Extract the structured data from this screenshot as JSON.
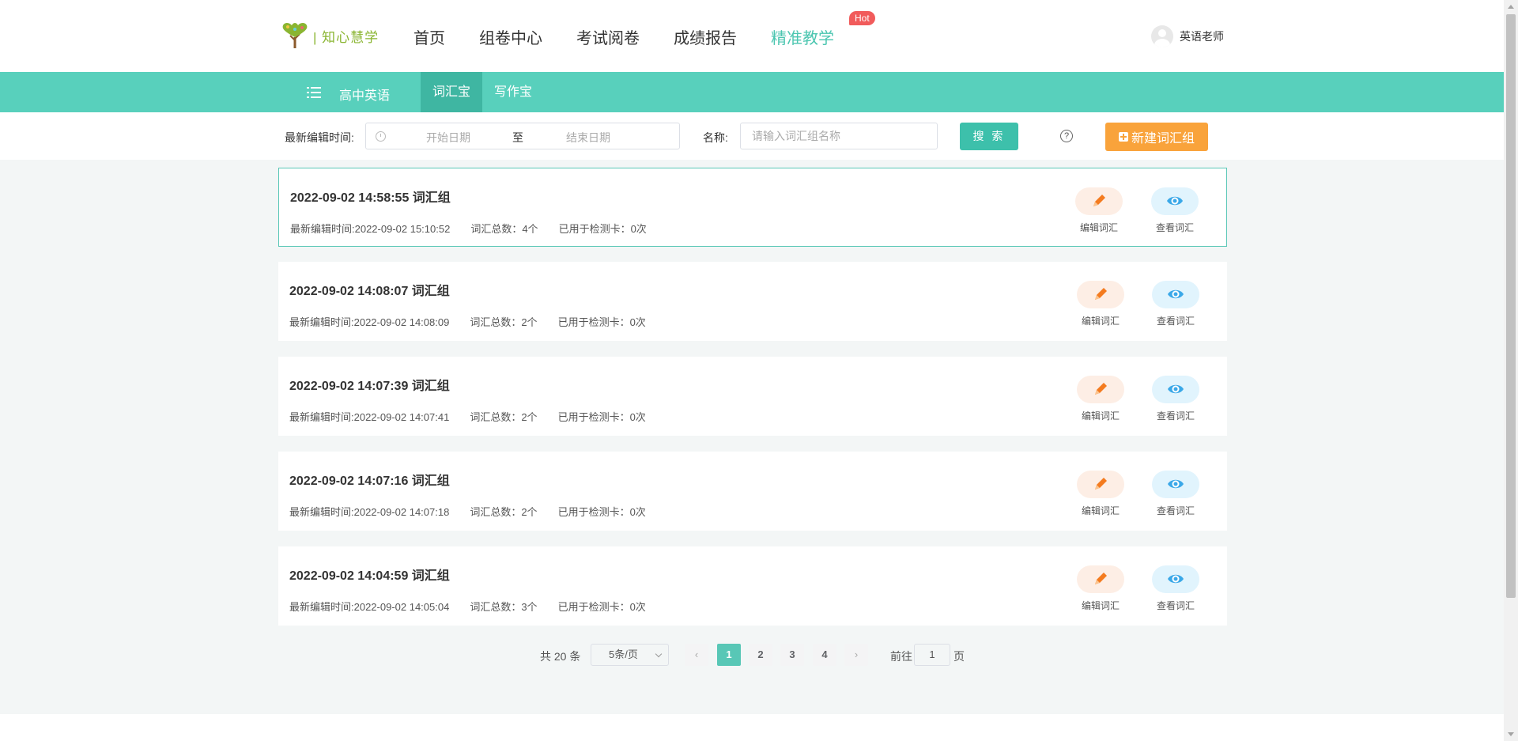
{
  "header": {
    "logo_text": "| 知心慧学",
    "nav": [
      {
        "label": "首页",
        "active": false
      },
      {
        "label": "组卷中心",
        "active": false
      },
      {
        "label": "考试阅卷",
        "active": false
      },
      {
        "label": "成绩报告",
        "active": false
      },
      {
        "label": "精准教学",
        "active": true
      }
    ],
    "hot_badge": "Hot",
    "user_name": "英语老师"
  },
  "subnav": {
    "subject": "高中英语",
    "tabs": [
      {
        "label": "词汇宝",
        "active": true
      },
      {
        "label": "写作宝",
        "active": false
      }
    ]
  },
  "filter": {
    "time_label": "最新编辑时间:",
    "start_placeholder": "开始日期",
    "range_separator": "至",
    "end_placeholder": "结束日期",
    "name_label": "名称:",
    "name_placeholder": "请输入词汇组名称",
    "search_label": "搜 索",
    "help_symbol": "?",
    "new_label": "新建词汇组"
  },
  "groups": [
    {
      "title": "2022-09-02 14:58:55 词汇组",
      "edit_time": "最新编辑时间:2022-09-02 15:10:52",
      "total": "词汇总数：4个",
      "used": "已用于检测卡：0次"
    },
    {
      "title": "2022-09-02 14:08:07 词汇组",
      "edit_time": "最新编辑时间:2022-09-02 14:08:09",
      "total": "词汇总数：2个",
      "used": "已用于检测卡：0次"
    },
    {
      "title": "2022-09-02 14:07:39 词汇组",
      "edit_time": "最新编辑时间:2022-09-02 14:07:41",
      "total": "词汇总数：2个",
      "used": "已用于检测卡：0次"
    },
    {
      "title": "2022-09-02 14:07:16 词汇组",
      "edit_time": "最新编辑时间:2022-09-02 14:07:18",
      "total": "词汇总数：2个",
      "used": "已用于检测卡：0次"
    },
    {
      "title": "2022-09-02 14:04:59 词汇组",
      "edit_time": "最新编辑时间:2022-09-02 14:05:04",
      "total": "词汇总数：3个",
      "used": "已用于检测卡：0次"
    }
  ],
  "actions": {
    "edit_label": "编辑词汇",
    "view_label": "查看词汇",
    "edit_icon": "pencil-icon",
    "view_icon": "eye-icon"
  },
  "pagination": {
    "total_text": "共 20 条",
    "page_size": "5条/页",
    "pages": [
      "1",
      "2",
      "3",
      "4"
    ],
    "current": "1",
    "prev_symbol": "‹",
    "next_symbol": "›",
    "goto_label": "前往",
    "goto_value": "1",
    "page_suffix": "页"
  },
  "colors": {
    "teal": "#58d0bc",
    "teal_active": "#3fb6a2",
    "orange": "#f9a33b",
    "hot_red": "#f15b5b",
    "logo_green": "#8ab531"
  }
}
